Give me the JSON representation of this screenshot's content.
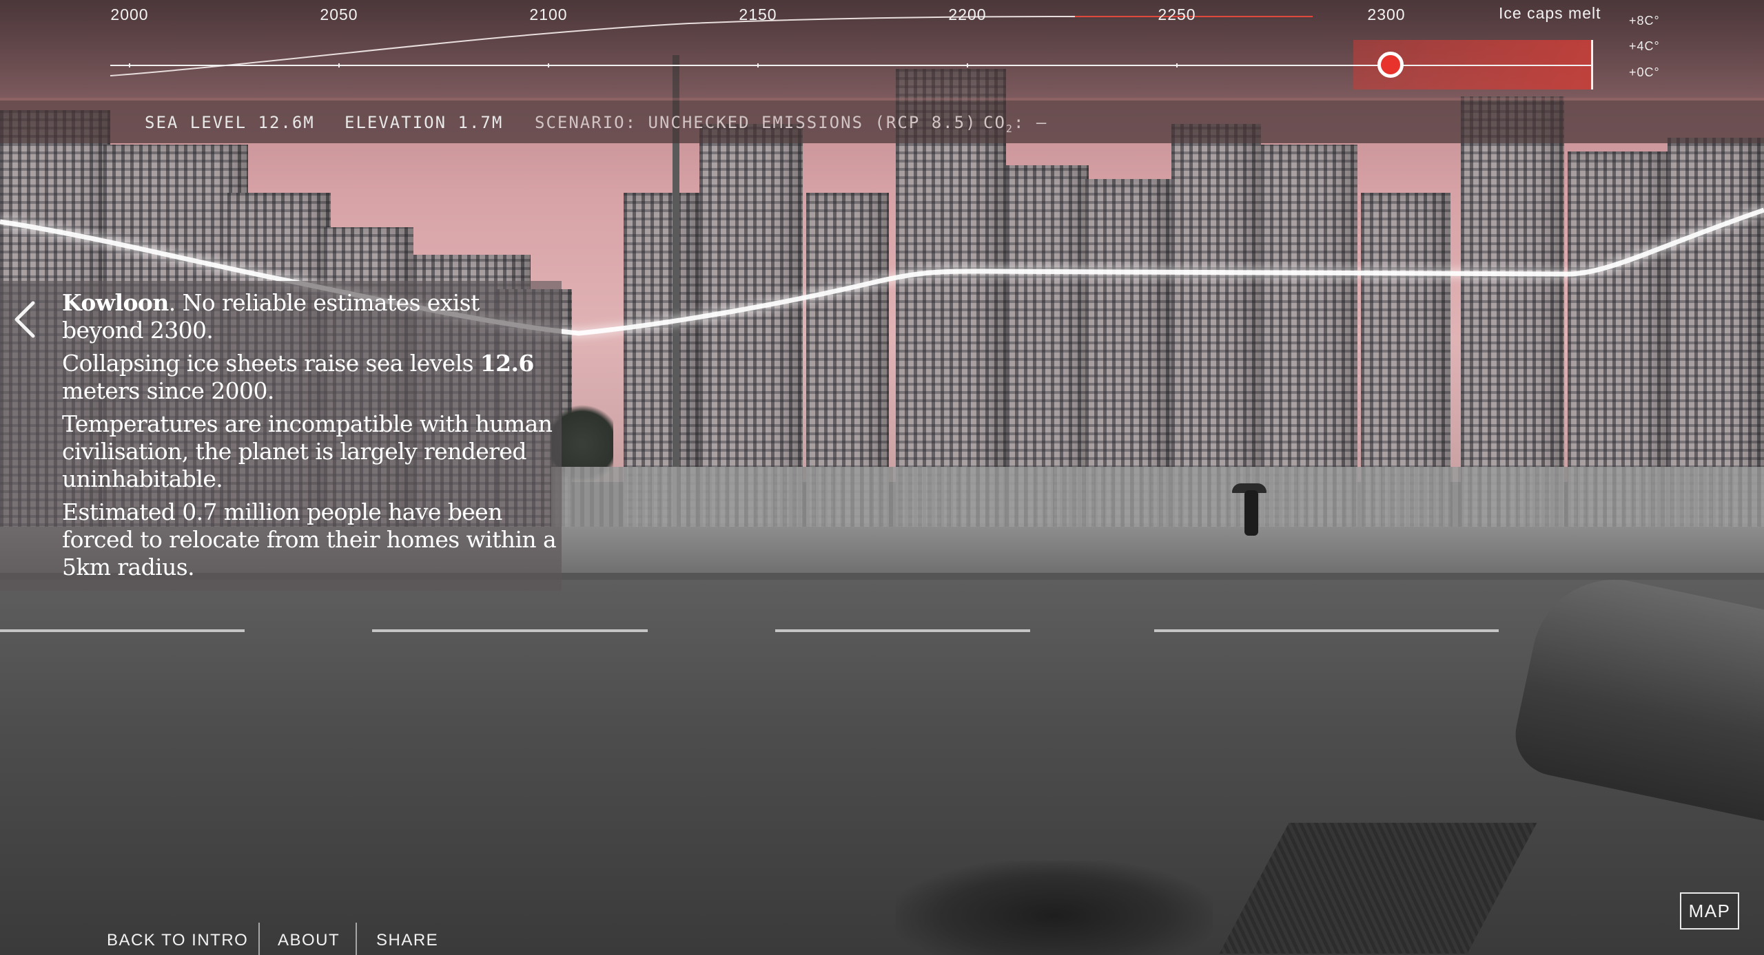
{
  "timeline": {
    "ticks": [
      "2000",
      "2050",
      "2100",
      "2150",
      "2200",
      "2250",
      "2300"
    ],
    "end_label": "Ice caps melt",
    "temps": [
      "+8C°",
      "+4C°",
      "+0C°"
    ],
    "selected_year": 2300
  },
  "stats": {
    "sea_level": "SEA LEVEL 12.6M",
    "elevation": "ELEVATION 1.7M",
    "scenario": "SCENARIO: UNCHECKED EMISSIONS (RCP 8.5)",
    "co2_prefix": "CO",
    "co2_sub": "2",
    "co2_value": ": –"
  },
  "info": {
    "place": "Kowloon",
    "p1_rest": ". No reliable estimates exist beyond 2300.",
    "p2_before": "Collapsing ice sheets raise sea levels ",
    "p2_value": "12.6",
    "p2_after": " meters since 2000.",
    "p3": "Temperatures are incompatible with human civilisation, the planet is largely rendered uninhabitable.",
    "p4": "Estimated  0.7 million  people have been forced to relocate from their homes within a 5km radius."
  },
  "footer": {
    "back_to_intro": "BACK TO INTRO",
    "about": "ABOUT",
    "share": "SHARE"
  },
  "map_button": "MAP",
  "colors": {
    "accent_red": "#e8322c",
    "sea_line": "#ffffff"
  }
}
